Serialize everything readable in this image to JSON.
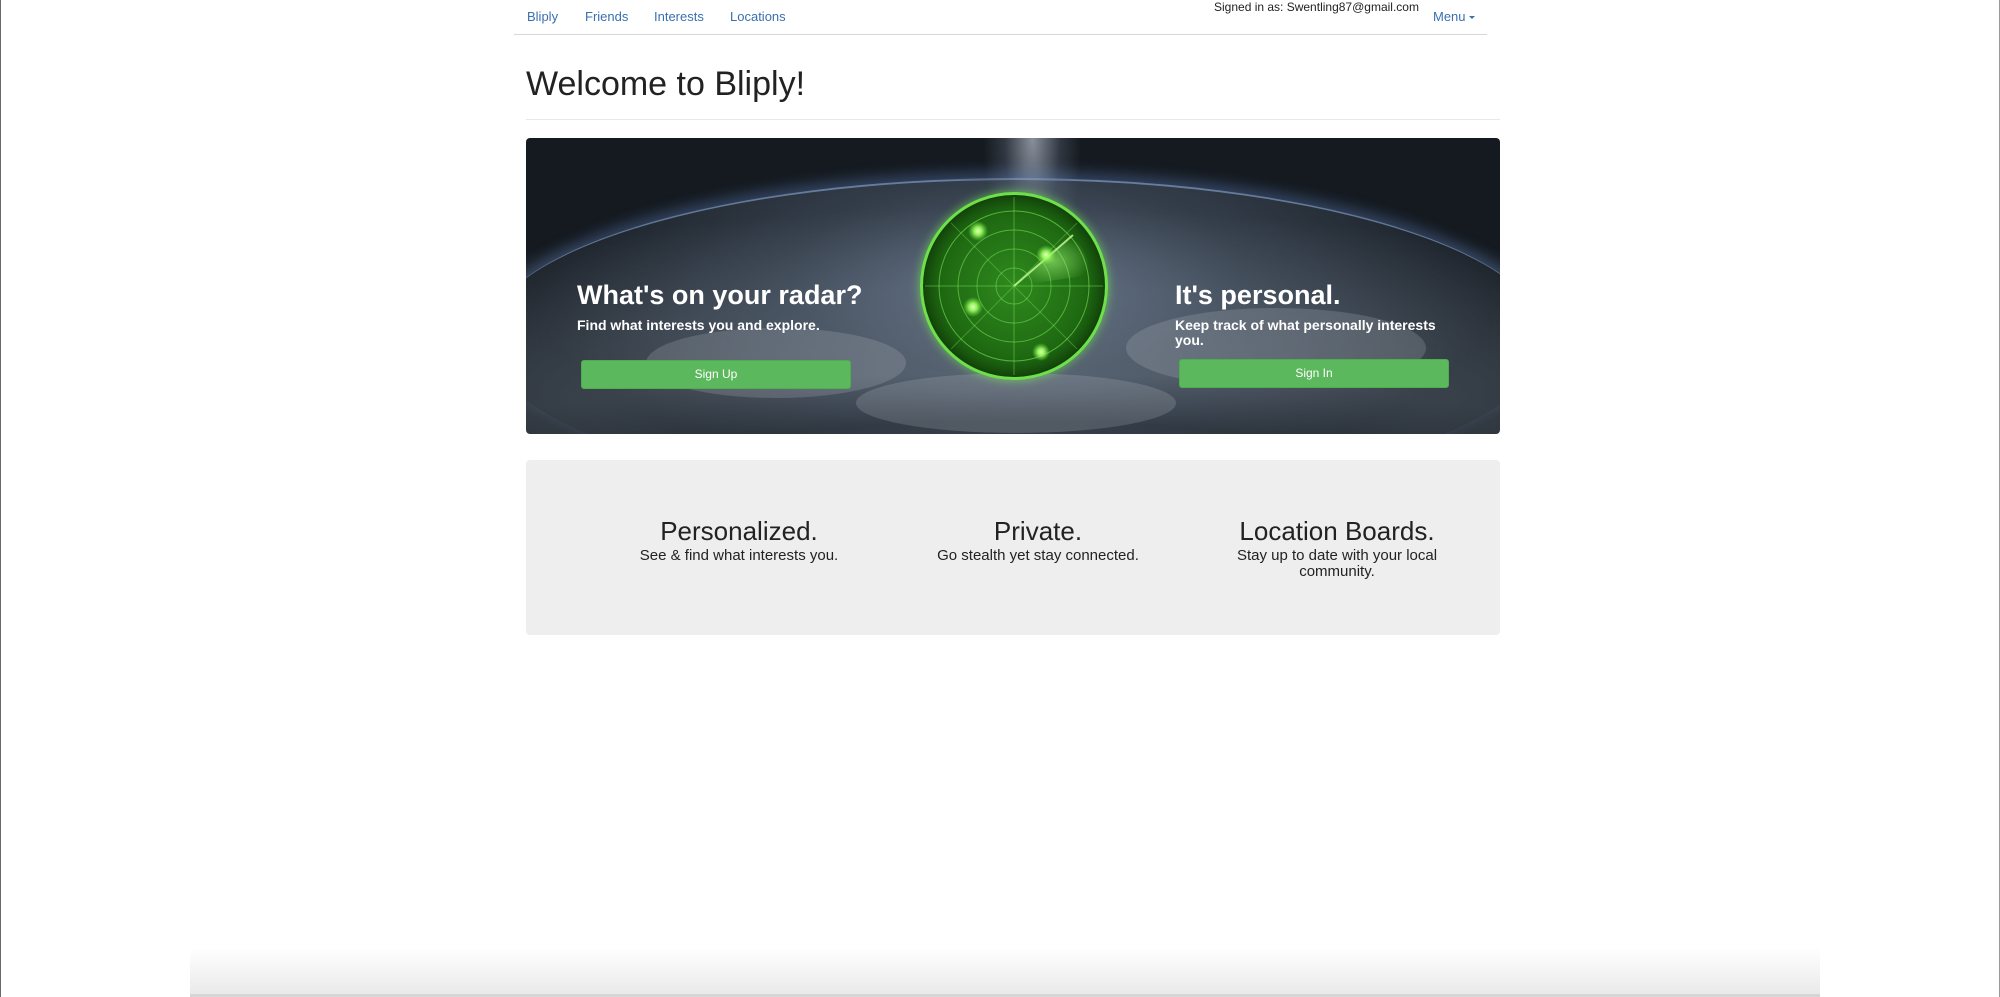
{
  "navbar": {
    "brand": "Bliply",
    "links": [
      {
        "label": "Friends"
      },
      {
        "label": "Interests"
      },
      {
        "label": "Locations"
      }
    ],
    "signed_in_text": "Signed in as: Swentling87@gmail.com",
    "menu_label": "Menu"
  },
  "page": {
    "title": "Welcome to Bliply!"
  },
  "hero": {
    "left": {
      "heading": "What's on your radar?",
      "subtext": "Find what interests you and explore.",
      "button_label": "Sign Up"
    },
    "right": {
      "heading": "It's personal.",
      "subtext": "Keep track of what personally interests you.",
      "button_label": "Sign In"
    },
    "radar_icon": "radar-icon"
  },
  "features": [
    {
      "title": "Personalized.",
      "text": "See & find what interests you."
    },
    {
      "title": "Private.",
      "text": "Go stealth yet stay connected."
    },
    {
      "title": "Location Boards.",
      "text": "Stay up to date with your local community."
    }
  ],
  "colors": {
    "link": "#3a6fb0",
    "button_green": "#5cb85c",
    "features_bg": "#eeeeee",
    "radar_green": "#6ee04a"
  }
}
